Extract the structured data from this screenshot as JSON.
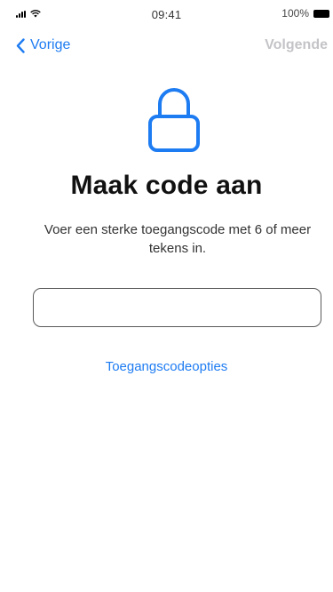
{
  "status_bar": {
    "time": "09:41",
    "battery_percent": "100%",
    "signal_icon": "cellular-signal-icon",
    "wifi_icon": "wifi-icon",
    "battery_icon": "battery-icon"
  },
  "nav": {
    "back_label": "Vorige",
    "next_label": "Volgende",
    "back_icon": "chevron-left-icon"
  },
  "main": {
    "icon": "lock-icon",
    "title": "Maak code aan",
    "description": "Voer een sterke toegangscode met 6 of meer tekens in.",
    "passcode_value": "",
    "passcode_placeholder": "",
    "options_link": "Toegangscodeopties"
  },
  "colors": {
    "accent": "#1e7cf2",
    "disabled": "#c4c4c8",
    "background": "#ffffff"
  }
}
